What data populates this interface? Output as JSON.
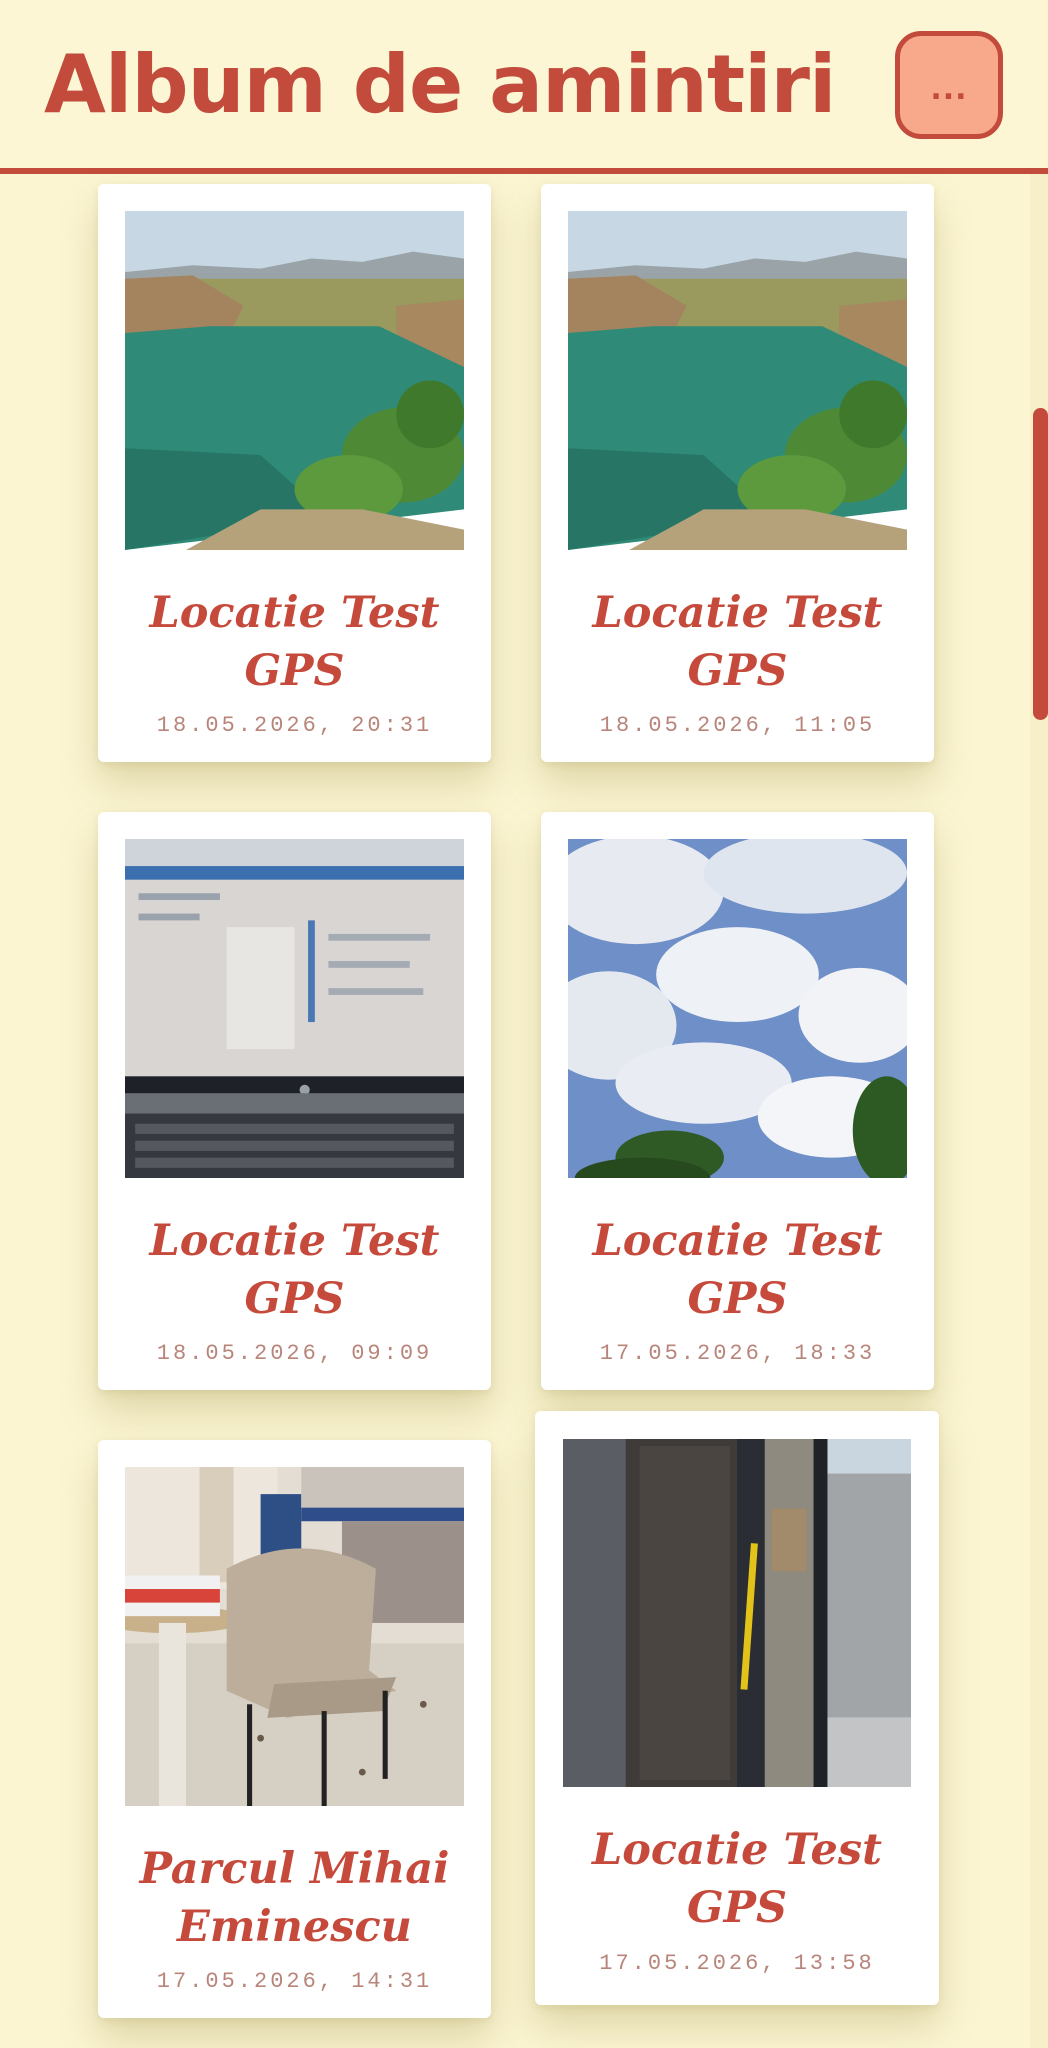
{
  "header": {
    "title": "Album de amintiri",
    "menu_label": "..."
  },
  "colors": {
    "accent": "#c24b3c",
    "background": "#fbf5d2",
    "menu_button": "#f9a98b",
    "date_text": "#b8857b"
  },
  "memories": [
    {
      "title_line1": "Locatie Test",
      "title_line2": "GPS",
      "date": "18.05.2026, 20:31",
      "photo": "lake-landscape"
    },
    {
      "title_line1": "Locatie Test",
      "title_line2": "GPS",
      "date": "18.05.2026, 11:05",
      "photo": "lake-landscape"
    },
    {
      "title_line1": "Locatie Test",
      "title_line2": "GPS",
      "date": "18.05.2026, 09:09",
      "photo": "laptop-screen"
    },
    {
      "title_line1": "Locatie Test",
      "title_line2": "GPS",
      "date": "17.05.2026, 18:33",
      "photo": "cloudy-sky"
    },
    {
      "title_line1": "Parcul Mihai",
      "title_line2": "Eminescu",
      "date": "17.05.2026, 14:31",
      "photo": "chair-and-table"
    },
    {
      "title_line1": "Locatie Test",
      "title_line2": "GPS",
      "date": "17.05.2026, 13:58",
      "photo": "bus-door"
    }
  ]
}
